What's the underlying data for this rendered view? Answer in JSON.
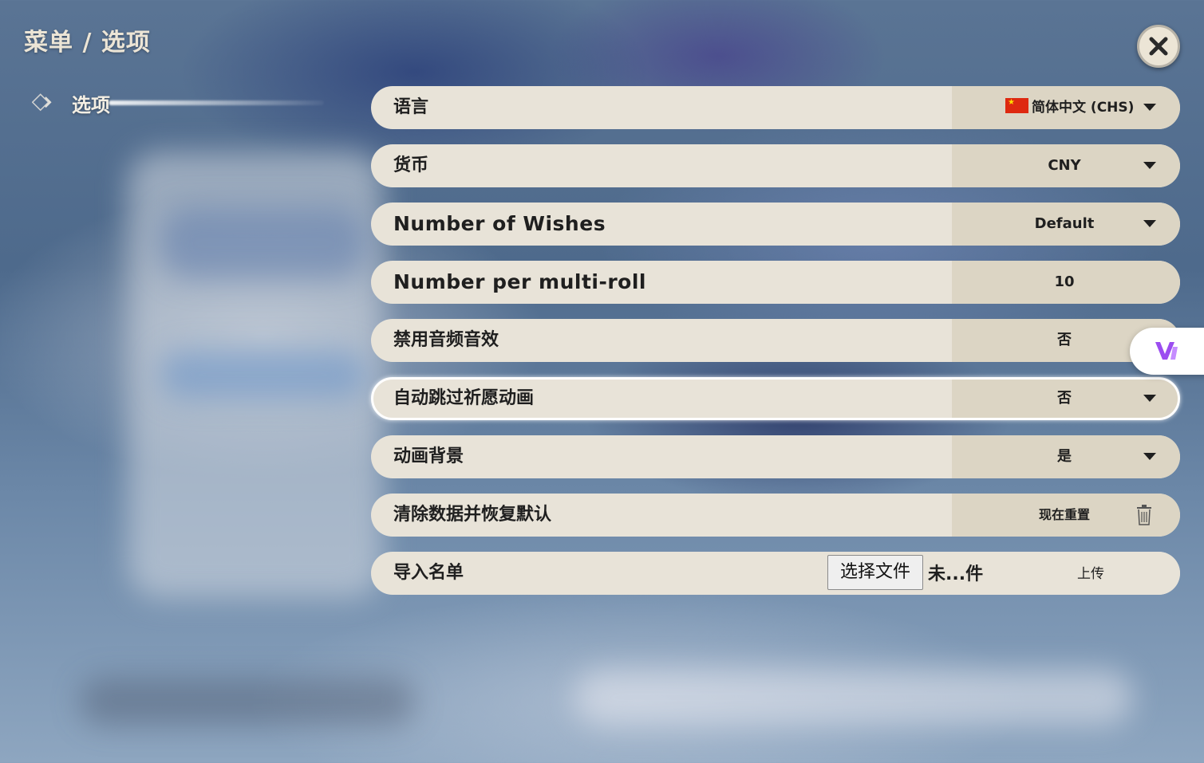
{
  "breadcrumb": "菜单 / 选项",
  "sidebar": {
    "items": [
      {
        "label": "选项",
        "icon": "diamond-arrow-icon"
      }
    ]
  },
  "settings": {
    "language": {
      "label": "语言",
      "value": "简体中文 (CHS)",
      "flag": "china-flag-icon"
    },
    "currency": {
      "label": "货币",
      "value": "CNY"
    },
    "wishes": {
      "label": "Number of Wishes",
      "value": "Default"
    },
    "multiroll": {
      "label": "Number per multi-roll",
      "value": "10"
    },
    "audio": {
      "label": "禁用音频音效",
      "value": "否"
    },
    "skip_anim": {
      "label": "自动跳过祈愿动画",
      "value": "否"
    },
    "anim_bg": {
      "label": "动画背景",
      "value": "是"
    },
    "reset": {
      "label": "清除数据并恢复默认",
      "value": "现在重置"
    },
    "import": {
      "label": "导入名单",
      "button": "选择文件",
      "file": "未...件",
      "upload": "上传"
    }
  },
  "colors": {
    "row_bg": "#e8e3d8",
    "row_value_bg": "#dcd5c4",
    "text": "#1f1f1f",
    "title": "#ece5d6",
    "ext_accent": "#9b4df0"
  }
}
